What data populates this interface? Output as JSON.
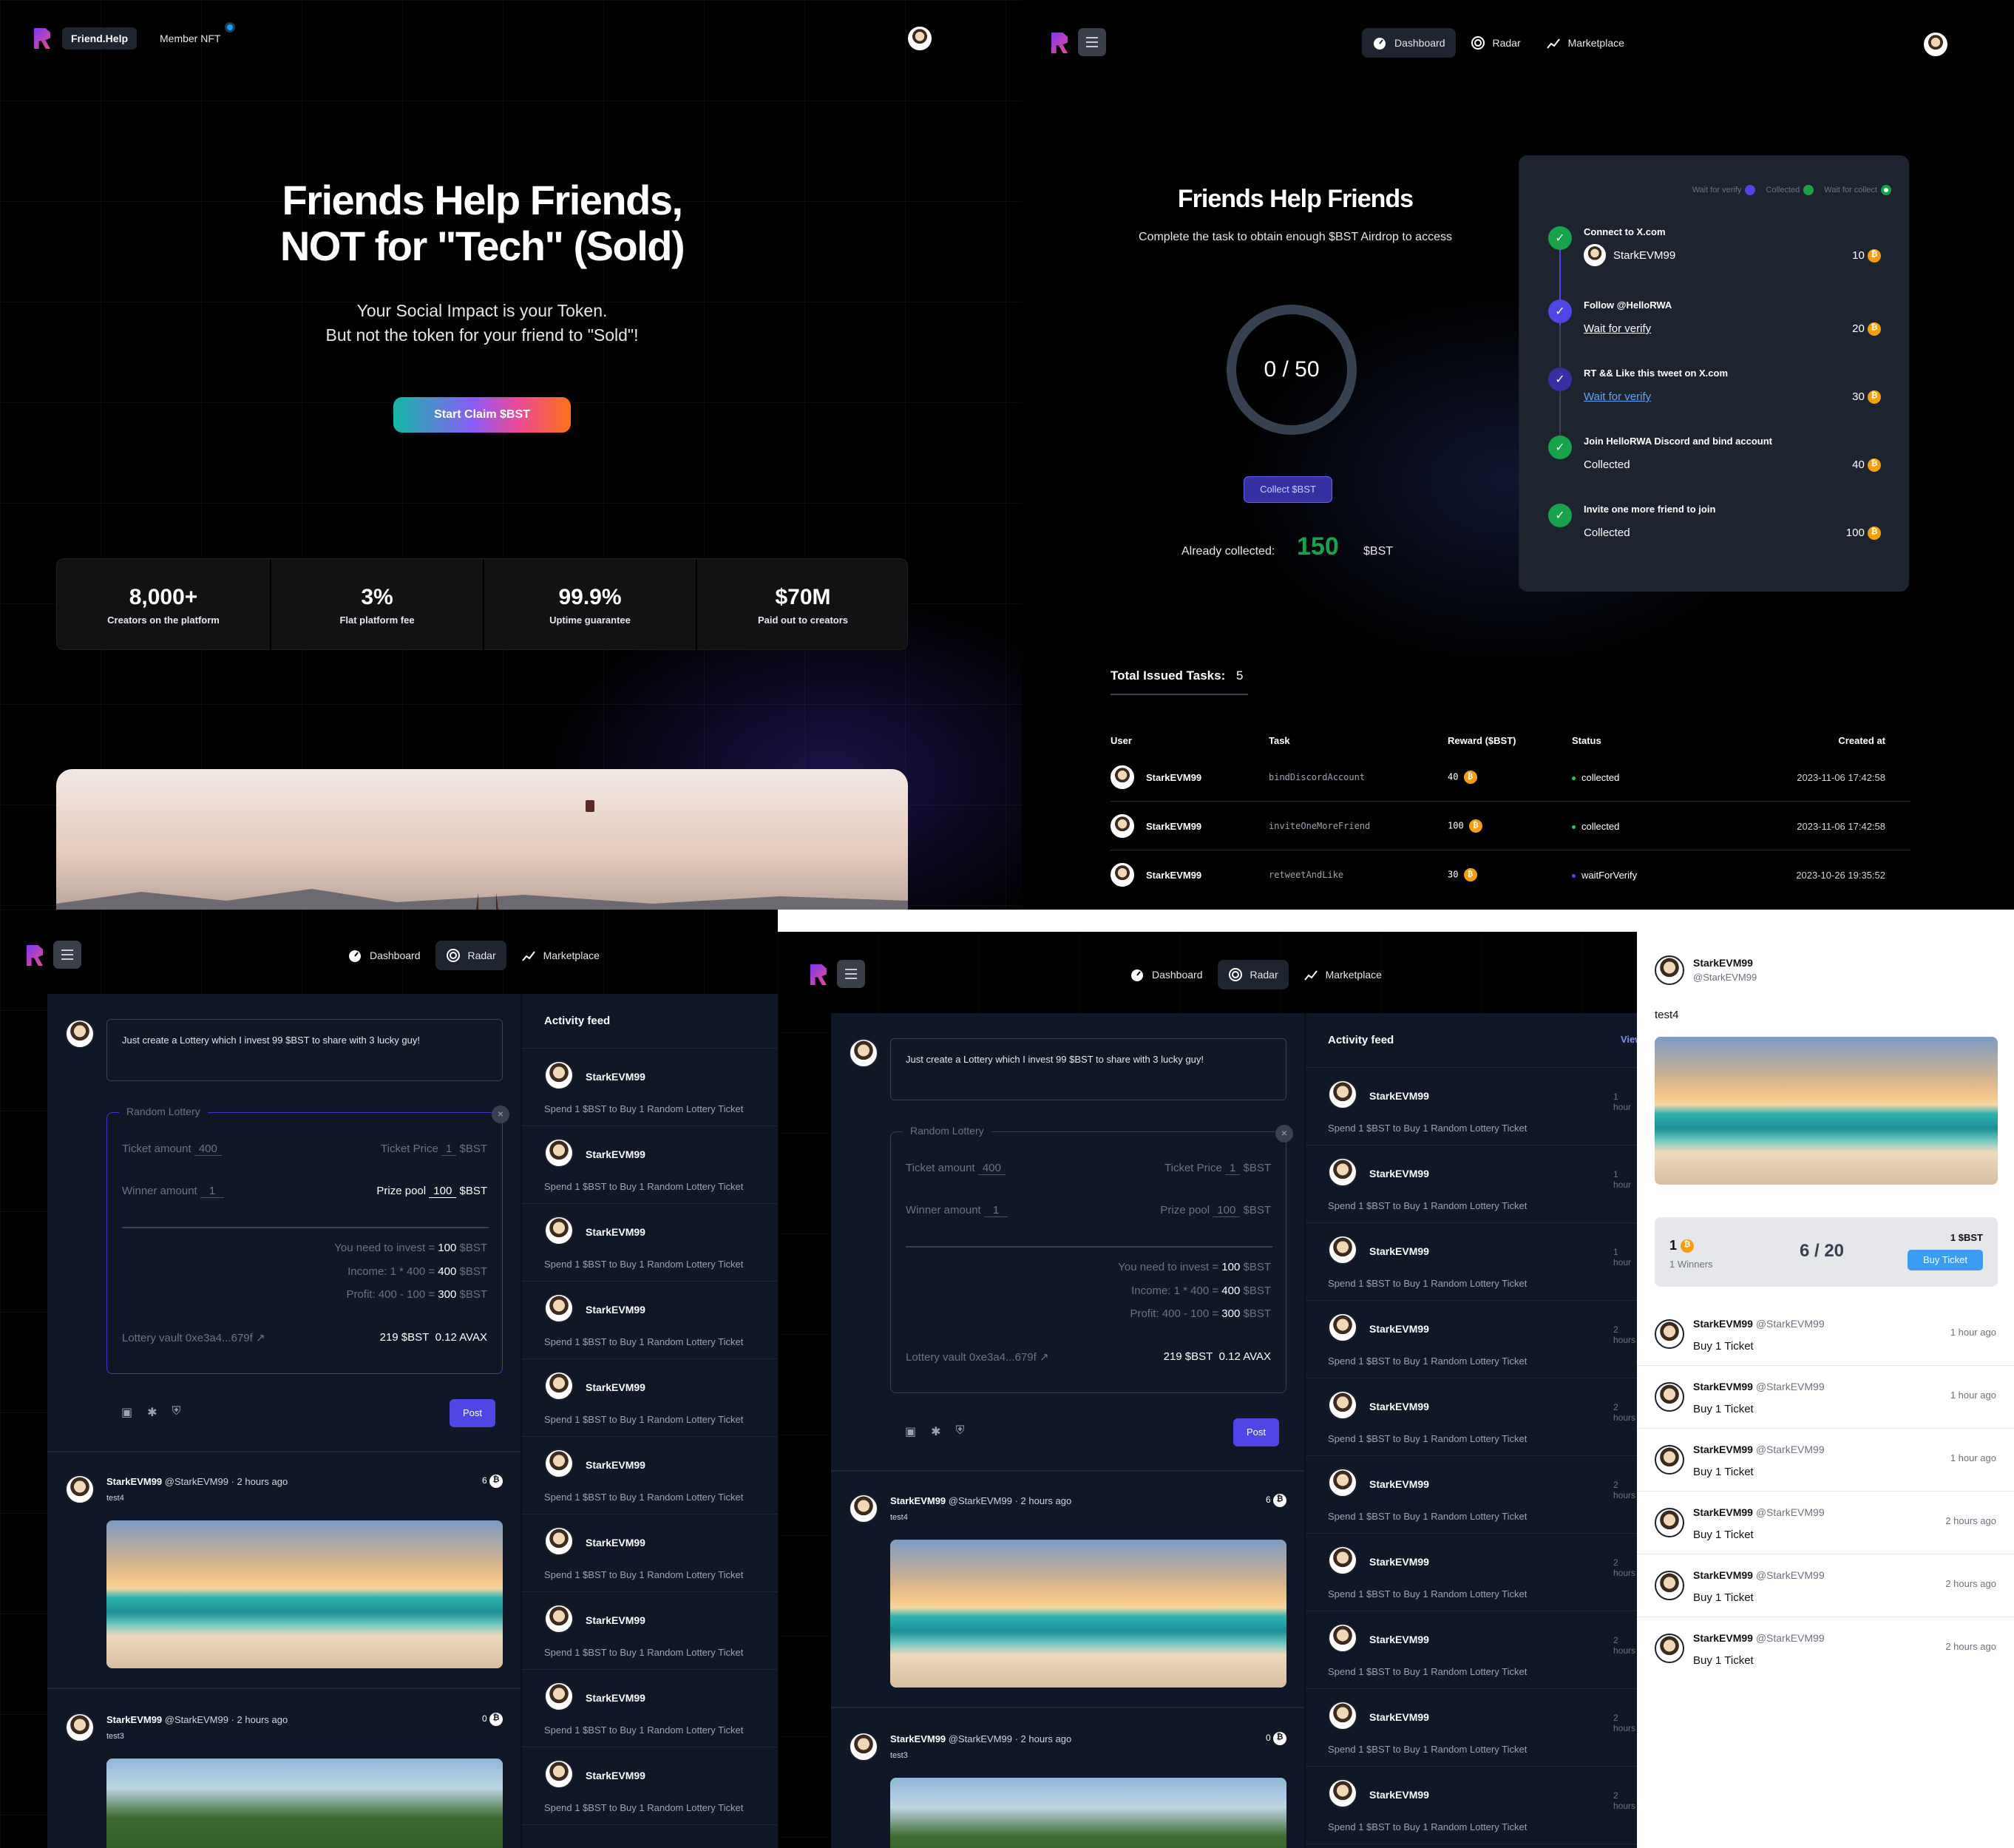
{
  "panel1": {
    "brand": "Friend.Help",
    "nav_member": "Member NFT",
    "hero_line1": "Friends Help Friends,",
    "hero_line2": "NOT for \"Tech\" (Sold)",
    "sub_line1": "Your Social Impact is your Token.",
    "sub_line2": "But not the token for your friend to \"Sold\"!",
    "cta": "Start Claim $BST",
    "stats": [
      {
        "value": "8,000+",
        "label": "Creators on the platform"
      },
      {
        "value": "3%",
        "label": "Flat platform fee"
      },
      {
        "value": "99.9%",
        "label": "Uptime guarantee"
      },
      {
        "value": "$70M",
        "label": "Paid out to creators"
      }
    ]
  },
  "nav": {
    "dashboard": "Dashboard",
    "radar": "Radar",
    "marketplace": "Marketplace"
  },
  "panel2": {
    "title": "Friends Help Friends",
    "subtitle": "Complete the task to obtain enough $BST Airdrop to access",
    "progress_text": "0 / 50",
    "progress_value": 0,
    "progress_max": 50,
    "collect_button": "Collect $BST",
    "already_label": "Already collected:",
    "already_value": "150",
    "already_unit": "$BST",
    "legend": [
      "Wait for verify",
      "Collected",
      "Wait for collect"
    ],
    "tasks": [
      {
        "title": "Connect to X.com",
        "status": "StarkEVM99",
        "reward": "10"
      },
      {
        "title": "Follow @HelloRWA",
        "status": "Wait for verify",
        "reward": "20"
      },
      {
        "title": "RT && Like this tweet on X.com",
        "status": "Wait for verify",
        "reward": "30"
      },
      {
        "title": "Join HelloRWA Discord and bind account",
        "status": "Collected",
        "reward": "40"
      },
      {
        "title": "Invite one more friend to join",
        "status": "Collected",
        "reward": "100"
      }
    ],
    "total_label": "Total Issued Tasks:",
    "total_value": "5",
    "table_headers": [
      "User",
      "Task",
      "Reward ($BST)",
      "Status",
      "Created at"
    ],
    "table_rows": [
      {
        "user": "StarkEVM99",
        "task": "bindDiscordAccount",
        "reward": "40",
        "status": "collected",
        "created": "2023-11-06 17:42:58"
      },
      {
        "user": "StarkEVM99",
        "task": "inviteOneMoreFriend",
        "reward": "100",
        "status": "collected",
        "created": "2023-11-06 17:42:58"
      },
      {
        "user": "StarkEVM99",
        "task": "retweetAndLike",
        "reward": "30",
        "status": "waitForVerify",
        "created": "2023-10-26 19:35:52"
      }
    ]
  },
  "radar": {
    "compose_text": "Just create a Lottery which I invest 99 $BST to share with 3 lucky guy!",
    "lottery_legend": "Random Lottery",
    "ticket_amount_label": "Ticket amount",
    "ticket_amount": "400",
    "ticket_price_label": "Ticket Price",
    "ticket_price": "1",
    "unit": "$BST",
    "winner_amount_label": "Winner amount",
    "winner_amount": "1",
    "prize_pool_label": "Prize pool",
    "prize_pool": "100",
    "invest_label": "You need to invest",
    "invest_value": "100",
    "income_label": "Income: 1 * 400",
    "income_value": "400",
    "profit_label": "Profit: 400 - 100",
    "profit_value": "300",
    "eq": "=",
    "vault_label": "Lottery vault",
    "vault_addr": "0xe3a4...679f",
    "vault_bst": "219 $BST",
    "vault_avax": "0.12 AVAX",
    "post_button": "Post",
    "posts": [
      {
        "name": "StarkEVM99",
        "handle": "@StarkEVM99",
        "time": "2 hours ago",
        "text": "test4",
        "count": "6"
      },
      {
        "name": "StarkEVM99",
        "handle": "@StarkEVM99",
        "time": "2 hours ago",
        "text": "test3",
        "count": "0"
      }
    ],
    "feed_title": "Activity feed",
    "feed_view": "View",
    "feed_name": "StarkEVM99",
    "feed_desc": "Spend 1 $BST to Buy 1 Random Lottery Ticket",
    "feed_times": [
      "1 hour",
      "1 hour",
      "1 hour",
      "2 hours",
      "2 hours",
      "2 hours",
      "2 hours",
      "2 hours",
      "2 hours",
      "2 hours"
    ],
    "dot": "·"
  },
  "detail": {
    "name": "StarkEVM99",
    "handle": "@StarkEVM99",
    "text": "test4",
    "prize": "1",
    "winners": "1 Winners",
    "sold": "6 / 20",
    "price": "1 $BST",
    "buy": "Buy Ticket",
    "buys": [
      {
        "action": "Buy 1 Ticket",
        "time": "1 hour ago"
      },
      {
        "action": "Buy 1 Ticket",
        "time": "1 hour ago"
      },
      {
        "action": "Buy 1 Ticket",
        "time": "1 hour ago"
      },
      {
        "action": "Buy 1 Ticket",
        "time": "2 hours ago"
      },
      {
        "action": "Buy 1 Ticket",
        "time": "2 hours ago"
      },
      {
        "action": "Buy 1 Ticket",
        "time": "2 hours ago"
      }
    ]
  }
}
